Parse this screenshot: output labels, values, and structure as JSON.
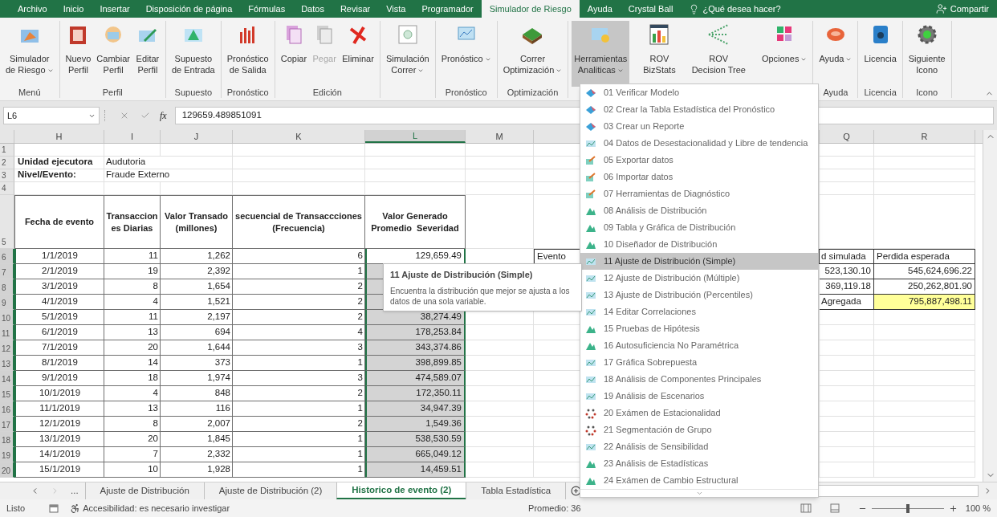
{
  "ribbon_tabs": [
    {
      "label": "Archivo",
      "selected": false
    },
    {
      "label": "Inicio",
      "selected": false
    },
    {
      "label": "Insertar",
      "selected": false
    },
    {
      "label": "Disposición de página",
      "selected": false
    },
    {
      "label": "Fórmulas",
      "selected": false
    },
    {
      "label": "Datos",
      "selected": false
    },
    {
      "label": "Revisar",
      "selected": false
    },
    {
      "label": "Vista",
      "selected": false
    },
    {
      "label": "Programador",
      "selected": false
    },
    {
      "label": "Simulador de Riesgo",
      "selected": true
    },
    {
      "label": "Ayuda",
      "selected": false
    },
    {
      "label": "Crystal Ball",
      "selected": false
    }
  ],
  "tell_me": "¿Qué desea hacer?",
  "share": "Compartir",
  "ribbon_groups": [
    {
      "label": "Menú",
      "buttons": [
        {
          "lines": [
            "Simulador",
            "de Riesgo"
          ],
          "kind": "wizard",
          "dropdown": true,
          "disabled": false,
          "pressed": false
        }
      ]
    },
    {
      "label": "Perfil",
      "buttons": [
        {
          "lines": [
            "Nuevo",
            "Perfil"
          ],
          "kind": "newdoc",
          "dropdown": false,
          "disabled": false,
          "pressed": false
        },
        {
          "lines": [
            "Cambiar",
            "Perfil"
          ],
          "kind": "swap",
          "dropdown": false,
          "disabled": false,
          "pressed": false
        },
        {
          "lines": [
            "Editar",
            "Perfil"
          ],
          "kind": "edit",
          "dropdown": false,
          "disabled": false,
          "pressed": false
        }
      ]
    },
    {
      "label": "Supuesto",
      "buttons": [
        {
          "lines": [
            "Supuesto",
            "de Entrada"
          ],
          "kind": "triangle",
          "dropdown": false,
          "disabled": false,
          "pressed": false
        }
      ]
    },
    {
      "label": "Pronóstico",
      "buttons": [
        {
          "lines": [
            "Pronóstico",
            "de Salida"
          ],
          "kind": "bars",
          "dropdown": false,
          "disabled": false,
          "pressed": false
        }
      ]
    },
    {
      "label": "Edición",
      "buttons": [
        {
          "lines": [
            "Copiar"
          ],
          "kind": "copy",
          "dropdown": false,
          "disabled": false,
          "pressed": false
        },
        {
          "lines": [
            "Pegar"
          ],
          "kind": "paste",
          "dropdown": false,
          "disabled": true,
          "pressed": false
        },
        {
          "lines": [
            "Eliminar"
          ],
          "kind": "cross",
          "dropdown": false,
          "disabled": false,
          "pressed": false
        }
      ]
    },
    {
      "buttons": [
        {
          "lines": [
            "Simulación",
            "Correr"
          ],
          "kind": "disc",
          "dropdown": true,
          "disabled": false,
          "pressed": false
        }
      ]
    },
    {
      "label": "Pronóstico",
      "buttons": [
        {
          "lines": [
            "Pronóstico"
          ],
          "kind": "monitor",
          "dropdown": true,
          "disabled": false,
          "pressed": false
        }
      ]
    },
    {
      "label": "Optimización",
      "buttons": [
        {
          "lines": [
            "Correr",
            "Optimización"
          ],
          "kind": "terrain",
          "dropdown": true,
          "disabled": false,
          "pressed": false
        }
      ]
    },
    {
      "buttons": [
        {
          "lines": [
            "Herramientas",
            "Analiticas"
          ],
          "kind": "tools",
          "dropdown": true,
          "disabled": false,
          "pressed": true
        },
        {
          "lines": [
            "ROV",
            "BizStats"
          ],
          "kind": "barchart",
          "dropdown": false,
          "disabled": false,
          "pressed": false
        },
        {
          "lines": [
            "ROV",
            "Decision Tree"
          ],
          "kind": "tree",
          "dropdown": false,
          "disabled": false,
          "pressed": false
        },
        {
          "lines": [
            "Opciones"
          ],
          "kind": "tiles",
          "dropdown": true,
          "disabled": false,
          "pressed": false
        }
      ]
    },
    {
      "label": "Ayuda",
      "buttons": [
        {
          "lines": [
            "Ayuda"
          ],
          "kind": "oval",
          "dropdown": true,
          "disabled": false,
          "pressed": false
        }
      ]
    },
    {
      "label": "Licencia",
      "buttons": [
        {
          "lines": [
            "Licencia"
          ],
          "kind": "lock",
          "dropdown": false,
          "disabled": false,
          "pressed": false
        }
      ]
    },
    {
      "label": "Icono",
      "buttons": [
        {
          "lines": [
            "Siguiente",
            "Icono"
          ],
          "kind": "gear",
          "dropdown": false,
          "disabled": false,
          "pressed": false
        }
      ]
    }
  ],
  "formula_bar": {
    "name_box": "L6",
    "function_label": "fx",
    "value": "129659.489851091"
  },
  "columns": [
    {
      "label": "H",
      "selected": false
    },
    {
      "label": "I",
      "selected": false
    },
    {
      "label": "J",
      "selected": false
    },
    {
      "label": "K",
      "selected": false
    },
    {
      "label": "L",
      "selected": true
    },
    {
      "label": "M",
      "selected": false
    },
    {
      "label": "Q",
      "selected": false
    },
    {
      "label": "R",
      "selected": false
    }
  ],
  "row_headers": [
    {
      "label": "1",
      "selected": false
    },
    {
      "label": "2",
      "selected": false
    },
    {
      "label": "3",
      "selected": false
    },
    {
      "label": "4",
      "selected": false
    },
    {
      "label": "5",
      "selected": false
    },
    {
      "label": "6",
      "selected": true
    },
    {
      "label": "7",
      "selected": true
    },
    {
      "label": "8",
      "selected": true
    },
    {
      "label": "9",
      "selected": true
    },
    {
      "label": "10",
      "selected": true
    },
    {
      "label": "11",
      "selected": true
    },
    {
      "label": "12",
      "selected": true
    },
    {
      "label": "13",
      "selected": true
    },
    {
      "label": "14",
      "selected": true
    },
    {
      "label": "15",
      "selected": true
    },
    {
      "label": "16",
      "selected": true
    },
    {
      "label": "17",
      "selected": true
    },
    {
      "label": "18",
      "selected": true
    },
    {
      "label": "19",
      "selected": true
    },
    {
      "label": "20",
      "selected": true
    }
  ],
  "info": [
    {
      "label": "Unidad ejecutora",
      "value": "Audutoria"
    },
    {
      "label": "Nivel/Evento:",
      "value": "Fraude Externo"
    }
  ],
  "table": {
    "headers": [
      {
        "lines": [
          "Fecha de evento"
        ]
      },
      {
        "lines": [
          "Transaccion",
          "es Diarias"
        ]
      },
      {
        "lines": [
          "Valor Transado",
          "(millones)"
        ]
      },
      {
        "lines": [
          "secuencial de Transaccciones",
          "(Frecuencia)"
        ]
      },
      {
        "lines": [
          "Valor Generado",
          "Promedio  Severidad"
        ]
      }
    ],
    "rows": [
      {
        "date": "1/1/2019",
        "transactions": "11",
        "value": "1,262",
        "sequence": "6",
        "severity": "129,659.49",
        "active": true
      },
      {
        "date": "2/1/2019",
        "transactions": "19",
        "value": "2,392",
        "sequence": "1",
        "active": false
      },
      {
        "date": "3/1/2019",
        "transactions": "8",
        "value": "1,654",
        "sequence": "2",
        "active": false
      },
      {
        "date": "4/1/2019",
        "transactions": "4",
        "value": "1,521",
        "sequence": "2",
        "active": false
      },
      {
        "date": "5/1/2019",
        "transactions": "11",
        "value": "2,197",
        "sequence": "2",
        "severity": "38,274.49",
        "active": false
      },
      {
        "date": "6/1/2019",
        "transactions": "13",
        "value": "694",
        "sequence": "4",
        "severity": "178,253.84",
        "active": false
      },
      {
        "date": "7/1/2019",
        "transactions": "20",
        "value": "1,644",
        "sequence": "3",
        "severity": "343,374.86",
        "active": false
      },
      {
        "date": "8/1/2019",
        "transactions": "14",
        "value": "373",
        "sequence": "1",
        "severity": "398,899.85",
        "active": false
      },
      {
        "date": "9/1/2019",
        "transactions": "18",
        "value": "1,974",
        "sequence": "3",
        "severity": "474,589.07",
        "active": false
      },
      {
        "date": "10/1/2019",
        "transactions": "4",
        "value": "848",
        "sequence": "2",
        "severity": "172,350.11",
        "active": false
      },
      {
        "date": "11/1/2019",
        "transactions": "13",
        "value": "116",
        "sequence": "1",
        "severity": "34,947.39",
        "active": false
      },
      {
        "date": "12/1/2019",
        "transactions": "8",
        "value": "2,007",
        "sequence": "2",
        "severity": "1,549.36",
        "active": false
      },
      {
        "date": "13/1/2019",
        "transactions": "20",
        "value": "1,845",
        "sequence": "1",
        "severity": "538,530.59",
        "active": false
      },
      {
        "date": "14/1/2019",
        "transactions": "7",
        "value": "2,332",
        "sequence": "1",
        "severity": "665,049.12",
        "active": false
      },
      {
        "date": "15/1/2019",
        "transactions": "10",
        "value": "1,928",
        "sequence": "1",
        "severity": "14,459.51",
        "active": false
      }
    ]
  },
  "summary": {
    "event_label": "Evento",
    "headers": [
      "d simulada",
      "Perdida esperada"
    ],
    "rows": [
      {
        "simulated": "523,130.10",
        "expected": "545,624,696.22"
      },
      {
        "simulated": "369,119.18",
        "expected": "250,262,801.90"
      }
    ],
    "total": {
      "label": "Agregada",
      "value": "795,887,498.11"
    }
  },
  "tooltip": {
    "title": "11 Ajuste de Distribución (Simple)",
    "text": "Encuentra la distribución que mejor se ajusta a los datos de una sola variable."
  },
  "menu": [
    {
      "label": "01 Verificar Modelo",
      "kind": "gem",
      "selected": false
    },
    {
      "label": "02 Crear la Tabla Estadística del Pronóstico",
      "kind": "gem",
      "selected": false
    },
    {
      "label": "03 Crear un Reporte",
      "kind": "gem",
      "selected": false
    },
    {
      "label": "04 Datos de Desestacionalidad y Libre de tendencia",
      "kind": "chart",
      "selected": false
    },
    {
      "label": "05 Exportar datos",
      "kind": "arrow",
      "selected": false
    },
    {
      "label": "06 Importar datos",
      "kind": "arrow",
      "selected": false
    },
    {
      "label": "07 Herramientas de Diagnóstico",
      "kind": "arrow",
      "selected": false
    },
    {
      "label": "08 Análisis de Distribución",
      "kind": "mountain",
      "selected": false
    },
    {
      "label": "09 Tabla y Gráfica de Distribución",
      "kind": "mountain",
      "selected": false
    },
    {
      "label": "10 Diseñador de Distribución",
      "kind": "mountain",
      "selected": false
    },
    {
      "label": "11 Ajuste de Distribución (Simple)",
      "kind": "chart",
      "selected": true
    },
    {
      "label": "12 Ajuste de Distribución (Múltiple)",
      "kind": "chart",
      "selected": false
    },
    {
      "label": "13 Ajuste de Distribución (Percentiles)",
      "kind": "chart",
      "selected": false
    },
    {
      "label": "14 Editar Correlaciones",
      "kind": "chart",
      "selected": false
    },
    {
      "label": "15 Pruebas de Hipótesis",
      "kind": "mountain",
      "selected": false
    },
    {
      "label": "16 Autosuficiencia No Paramétrica",
      "kind": "mountain",
      "selected": false
    },
    {
      "label": "17 Gráfica Sobrepuesta",
      "kind": "chart",
      "selected": false
    },
    {
      "label": "18 Análisis de Componentes Principales",
      "kind": "chart",
      "selected": false
    },
    {
      "label": "19 Análisis de Escenarios",
      "kind": "chart",
      "selected": false
    },
    {
      "label": "20 Exámen de Estacionalidad",
      "kind": "dots",
      "selected": false
    },
    {
      "label": "21 Segmentación de Grupo",
      "kind": "dots",
      "selected": false
    },
    {
      "label": "22 Análisis de Sensibilidad",
      "kind": "chart",
      "selected": false
    },
    {
      "label": "23 Análisis de Estadísticas",
      "kind": "mountain",
      "selected": false
    },
    {
      "label": "24 Exámen de Cambio Estructural",
      "kind": "mountain",
      "selected": false
    }
  ],
  "sheet_more": "...",
  "sheet_tabs": [
    {
      "label": "Ajuste de Distribución",
      "selected": false
    },
    {
      "label": "Ajuste de Distribución (2)",
      "selected": false
    },
    {
      "label": "Historico de evento (2)",
      "selected": true
    },
    {
      "label": "Tabla Estadística",
      "selected": false
    }
  ],
  "status": {
    "ready": "Listo",
    "accessibility": "Accesibilidad: es necesario investigar",
    "average": "Promedio: 36",
    "zoom": "100 %"
  },
  "zoom_slider": {
    "level": 0.5
  }
}
